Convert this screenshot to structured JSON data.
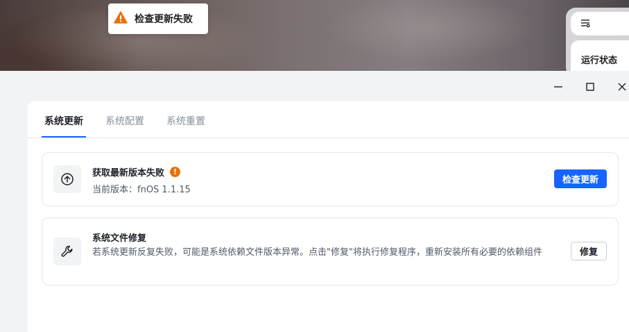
{
  "toast": {
    "icon": "warning-triangle-icon",
    "text": "检查更新失败",
    "color": "#e8710a"
  },
  "widget": {
    "icon": "filter-settings-icon",
    "title": "运行状态"
  },
  "window": {
    "controls": [
      "minimize",
      "maximize",
      "close"
    ]
  },
  "tabs": [
    {
      "label": "系统更新",
      "active": true
    },
    {
      "label": "系统配置",
      "active": false
    },
    {
      "label": "系统重置",
      "active": false
    }
  ],
  "update_card": {
    "icon": "arrow-up-circle-icon",
    "title": "获取最新版本失败",
    "status_icon": "warning-dot-icon",
    "current_version_label": "当前版本：fnOS 1.1.15",
    "button_label": "检查更新"
  },
  "repair_card": {
    "icon": "wrench-icon",
    "title": "系统文件修复",
    "description": "若系统更新反复失败，可能是系统依赖文件版本异常。点击\"修复\"将执行修复程序，重新安装所有必要的依赖组件",
    "button_label": "修复"
  },
  "colors": {
    "accent": "#1664ff",
    "warning": "#e8710a"
  }
}
